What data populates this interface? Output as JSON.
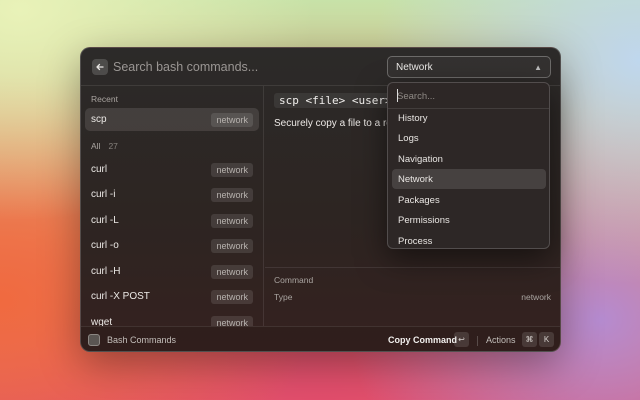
{
  "search": {
    "placeholder": "Search bash commands..."
  },
  "filter": {
    "selected": "Network"
  },
  "sections": {
    "recent_label": "Recent",
    "all_label": "All",
    "all_count": "27"
  },
  "recent": [
    {
      "name": "scp",
      "tag": "network"
    }
  ],
  "all": [
    {
      "name": "curl",
      "tag": "network"
    },
    {
      "name": "curl -i",
      "tag": "network"
    },
    {
      "name": "curl -L",
      "tag": "network"
    },
    {
      "name": "curl -o",
      "tag": "network"
    },
    {
      "name": "curl -H",
      "tag": "network"
    },
    {
      "name": "curl -X POST",
      "tag": "network"
    },
    {
      "name": "wget",
      "tag": "network"
    }
  ],
  "detail": {
    "command": "scp <file> <user>",
    "description": "Securely copy a file to a re",
    "meta": [
      {
        "label": "Command",
        "value": ""
      },
      {
        "label": "Type",
        "value": "network"
      }
    ]
  },
  "dropdown": {
    "search_placeholder": "Search...",
    "options": [
      "History",
      "Logs",
      "Navigation",
      "Network",
      "Packages",
      "Permissions",
      "Process"
    ],
    "active": "Network"
  },
  "footer": {
    "app_name": "Bash Commands",
    "primary_action": "Copy Command",
    "primary_key": "↩",
    "actions_label": "Actions",
    "actions_keys": [
      "⌘",
      "K"
    ]
  }
}
